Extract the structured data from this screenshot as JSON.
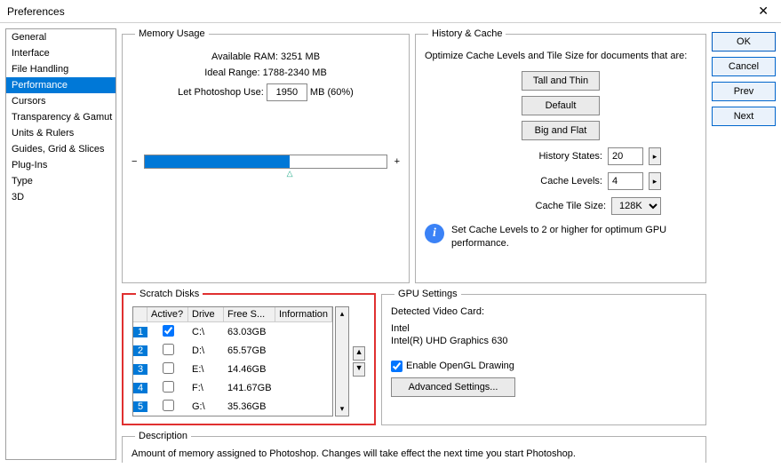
{
  "title": "Preferences",
  "sidebar": {
    "items": [
      {
        "label": "General"
      },
      {
        "label": "Interface"
      },
      {
        "label": "File Handling"
      },
      {
        "label": "Performance"
      },
      {
        "label": "Cursors"
      },
      {
        "label": "Transparency & Gamut"
      },
      {
        "label": "Units & Rulers"
      },
      {
        "label": "Guides, Grid & Slices"
      },
      {
        "label": "Plug-Ins"
      },
      {
        "label": "Type"
      },
      {
        "label": "3D"
      }
    ],
    "selected_index": 3
  },
  "memory": {
    "legend": "Memory Usage",
    "available_label": "Available RAM:",
    "available_value": "3251 MB",
    "ideal_label": "Ideal Range:",
    "ideal_value": "1788-2340 MB",
    "let_label": "Let Photoshop Use:",
    "use_value": "1950",
    "use_suffix": "MB (60%)",
    "minus": "−",
    "plus": "+"
  },
  "cache": {
    "legend": "History & Cache",
    "intro": "Optimize Cache Levels and Tile Size for documents that are:",
    "btn_tall": "Tall and Thin",
    "btn_default": "Default",
    "btn_big": "Big and Flat",
    "history_label": "History States:",
    "history_value": "20",
    "levels_label": "Cache Levels:",
    "levels_value": "4",
    "tile_label": "Cache Tile Size:",
    "tile_value": "128K",
    "info_text": "Set Cache Levels to 2 or higher for optimum GPU performance."
  },
  "scratch": {
    "legend": "Scratch Disks",
    "headers": {
      "active": "Active?",
      "drive": "Drive",
      "free": "Free S...",
      "info": "Information"
    },
    "rows": [
      {
        "n": "1",
        "active": true,
        "drive": "C:\\",
        "free": "63.03GB"
      },
      {
        "n": "2",
        "active": false,
        "drive": "D:\\",
        "free": "65.57GB"
      },
      {
        "n": "3",
        "active": false,
        "drive": "E:\\",
        "free": "14.46GB"
      },
      {
        "n": "4",
        "active": false,
        "drive": "F:\\",
        "free": "141.67GB"
      },
      {
        "n": "5",
        "active": false,
        "drive": "G:\\",
        "free": "35.36GB"
      }
    ]
  },
  "gpu": {
    "legend": "GPU Settings",
    "detected_label": "Detected Video Card:",
    "vendor": "Intel",
    "card": "Intel(R) UHD Graphics 630",
    "enable_label": "Enable OpenGL Drawing",
    "advanced": "Advanced Settings..."
  },
  "description": {
    "legend": "Description",
    "text": "Amount of memory assigned to Photoshop. Changes will take effect the next time you start Photoshop."
  },
  "buttons": {
    "ok": "OK",
    "cancel": "Cancel",
    "prev": "Prev",
    "next": "Next"
  }
}
